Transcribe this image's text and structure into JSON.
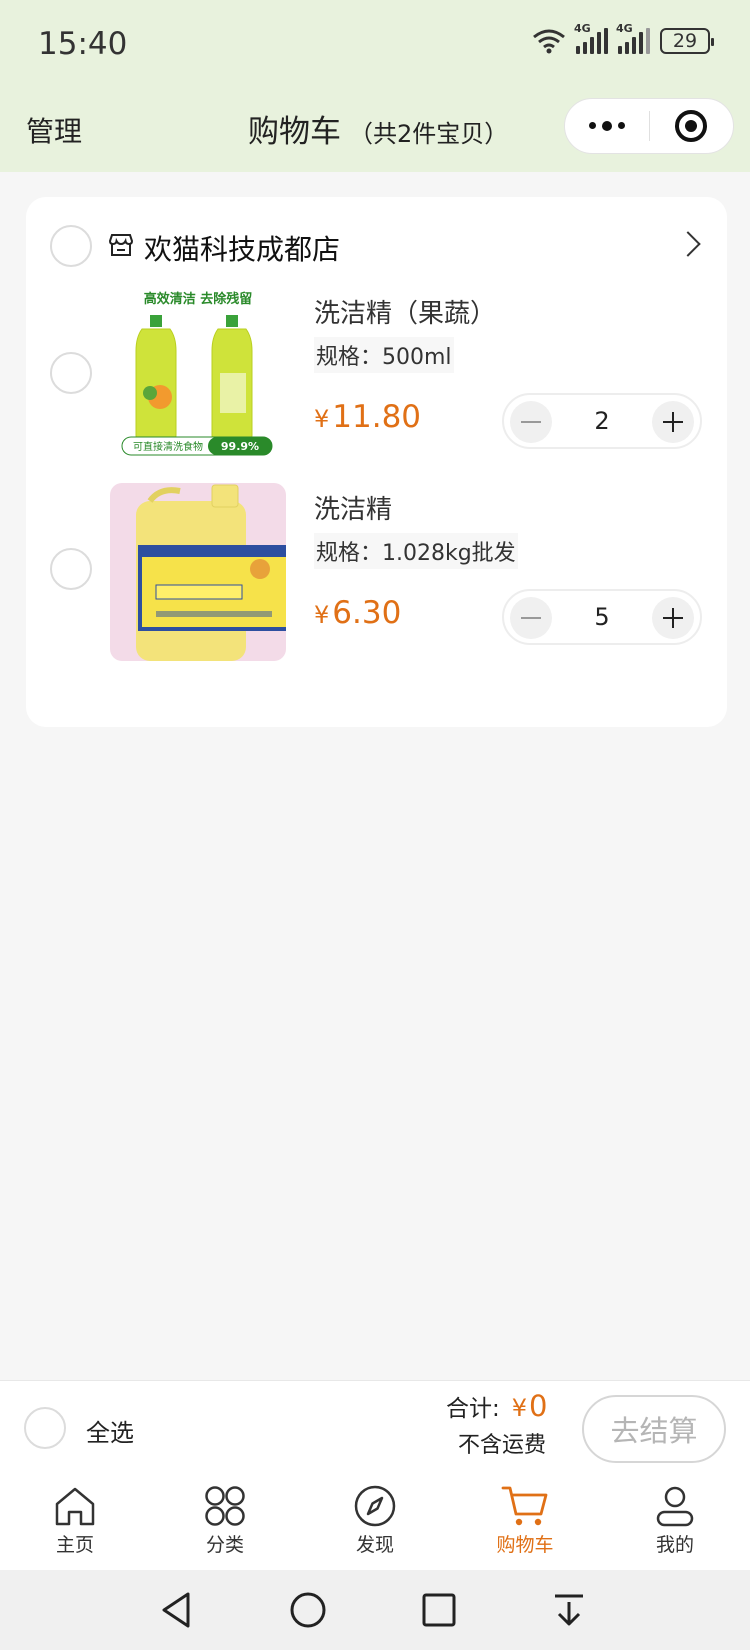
{
  "status_bar": {
    "time": "15:40",
    "battery": "29",
    "network_1": "4G",
    "network_2": "4G"
  },
  "nav": {
    "manage": "管理",
    "title": "购物车",
    "subtitle": "（共2件宝贝）",
    "more_icon": "more-dots-icon",
    "target_icon": "target-icon"
  },
  "shop": {
    "name": "欢猫科技成都店",
    "icon": "store-icon"
  },
  "items": [
    {
      "title": "洗洁精（果蔬）",
      "spec": "规格：500ml",
      "currency": "¥",
      "price": "11.80",
      "quantity": "2",
      "image_text_top": "高效清洁 去除残留",
      "image_text_bottom": "可直接清洗食物",
      "image_badge": "99.9%"
    },
    {
      "title": "洗洁精",
      "spec": "规格：1.028kg批发",
      "currency": "¥",
      "price": "6.30",
      "quantity": "5"
    }
  ],
  "bottom": {
    "select_all": "全选",
    "total_label": "合计:",
    "total_currency": "¥",
    "total_value": "0",
    "freight_note": "不含运费",
    "checkout": "去结算"
  },
  "tabs": [
    {
      "label": "主页",
      "icon": "home-icon"
    },
    {
      "label": "分类",
      "icon": "category-icon"
    },
    {
      "label": "发现",
      "icon": "compass-icon"
    },
    {
      "label": "购物车",
      "icon": "cart-icon",
      "active": true
    },
    {
      "label": "我的",
      "icon": "user-icon"
    }
  ],
  "colors": {
    "accent": "#e07016",
    "header_bg": "#e8f2dd",
    "page_bg": "#f6f6f6"
  }
}
